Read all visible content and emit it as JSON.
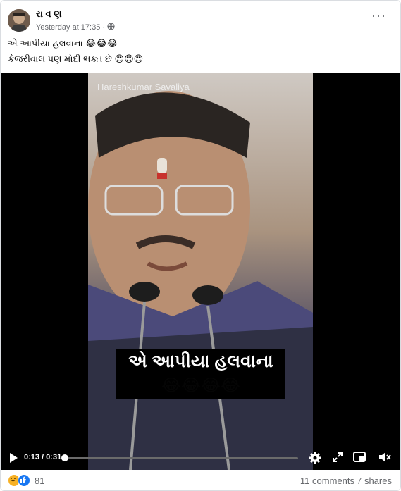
{
  "post": {
    "author": "રા વ ણ",
    "timestamp": "Yesterday at 17:35",
    "separator": "·",
    "caption_line1": "એ આપીયા હલવાના 😂😂😂",
    "caption_line2": "કેજરીવાલ પણ મોદી ભક્ત છે 😍😍😍",
    "more_options": "···"
  },
  "video": {
    "watermark": "Hareshkumar Savaliya",
    "subtitle_text": "એ આપીયા હલવાના",
    "subtitle_emoji": "😂😂😂😂",
    "current_time": "0:13",
    "duration": "0:31",
    "time_display": "0:13 / 0:31",
    "progress": 0.42
  },
  "footer": {
    "reaction_count": "81",
    "comments": "11 comments",
    "shares": "7 shares"
  },
  "colors": {
    "accent": "#1877f2",
    "haha": "#f7b125",
    "muted_text": "#65676b"
  }
}
